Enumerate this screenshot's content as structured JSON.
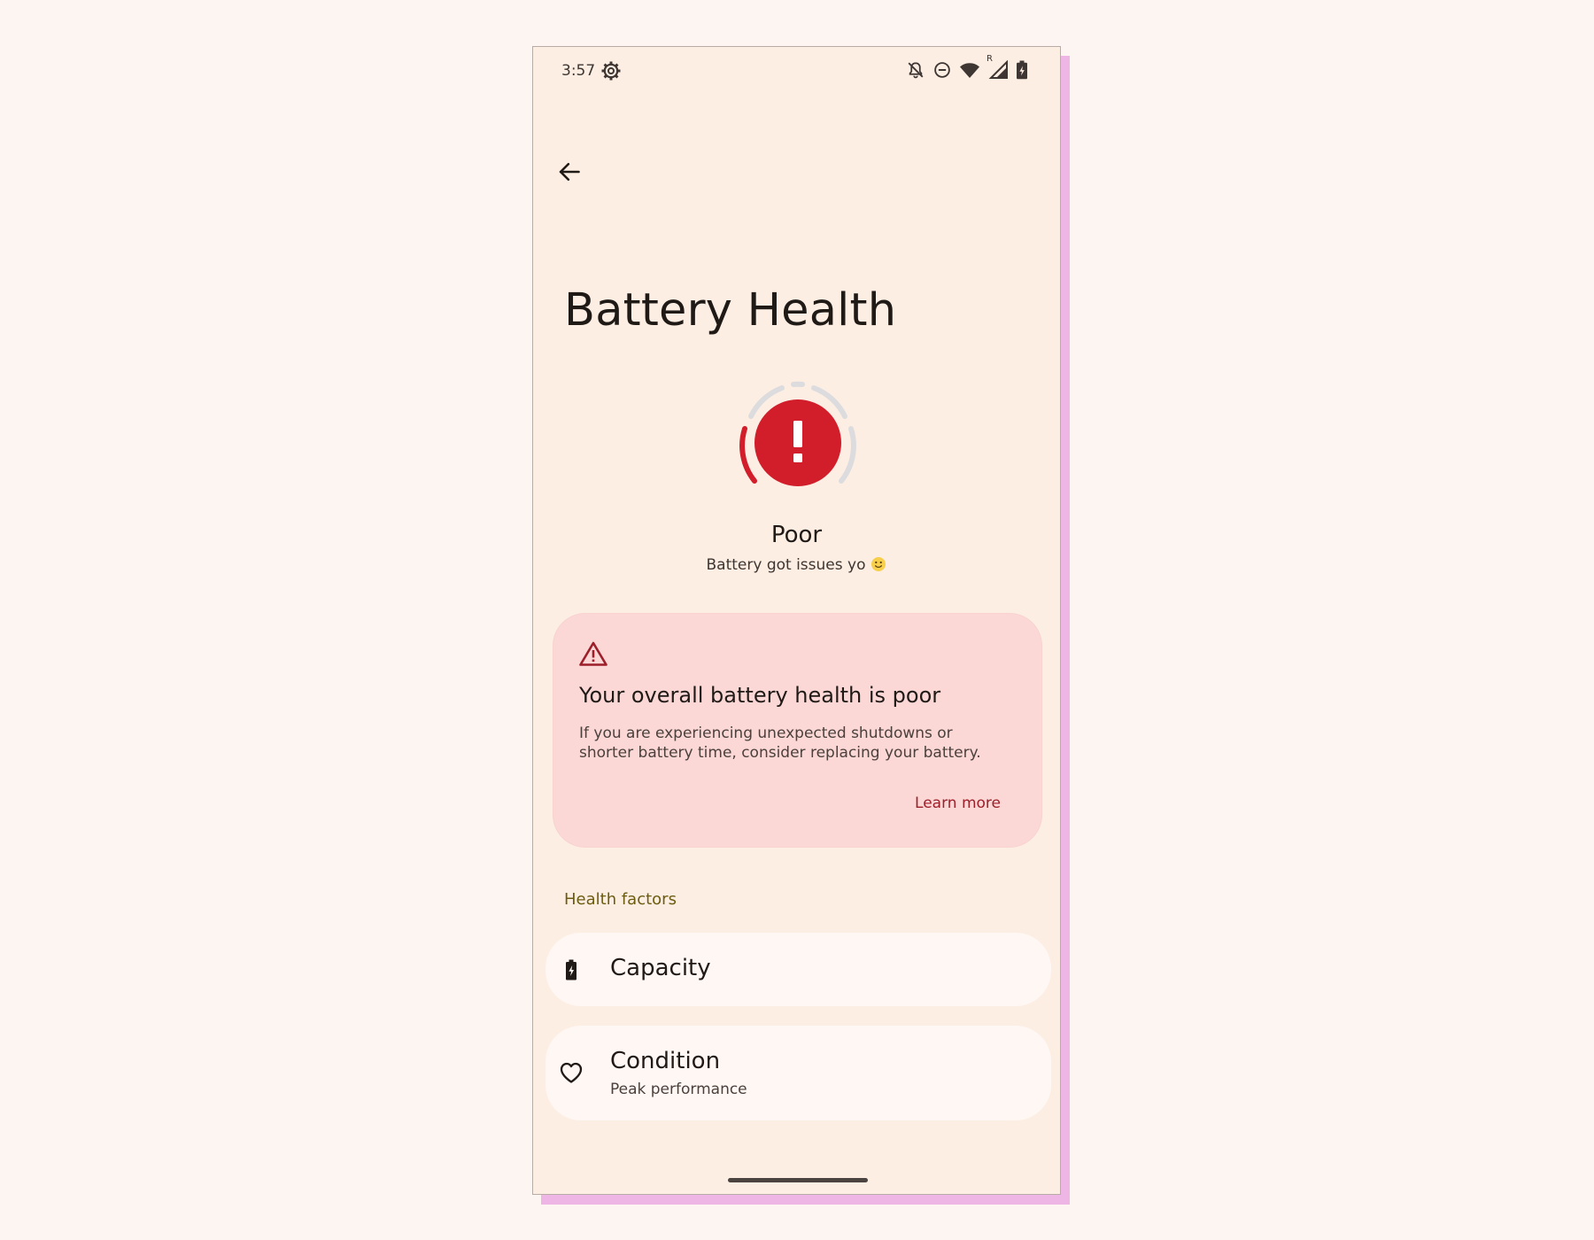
{
  "status_bar": {
    "time": "3:57",
    "icons": [
      "settings-gear-icon",
      "notifications-off-icon",
      "do-not-disturb-icon",
      "wifi-icon",
      "cell-signal-roaming-icon",
      "battery-charging-icon"
    ],
    "roaming_indicator": "R"
  },
  "navigation": {
    "back_icon": "arrow-back-icon"
  },
  "page": {
    "title": "Battery Health"
  },
  "health": {
    "status": "Poor",
    "subtitle": "Battery got issues yo",
    "subtitle_emoji": "slightly-smiling-face-emoji",
    "status_icon": "exclamation-icon",
    "alert_color": "#d21e2b",
    "track_color": "#dcdcdf"
  },
  "warning_card": {
    "icon": "warning-triangle-icon",
    "title": "Your overall battery health is poor",
    "body": "If you are experiencing unexpected shutdowns or shorter battery time, consider replacing your battery.",
    "action_label": "Learn more",
    "background_color": "#fbd7d6",
    "action_color": "#9c1f2a"
  },
  "health_factors": {
    "header": "Health factors",
    "items": [
      {
        "title": "Capacity",
        "summary": "",
        "icon": "battery-charging-icon"
      },
      {
        "title": "Condition",
        "summary": "Peak performance",
        "icon": "heart-outline-icon"
      }
    ]
  }
}
